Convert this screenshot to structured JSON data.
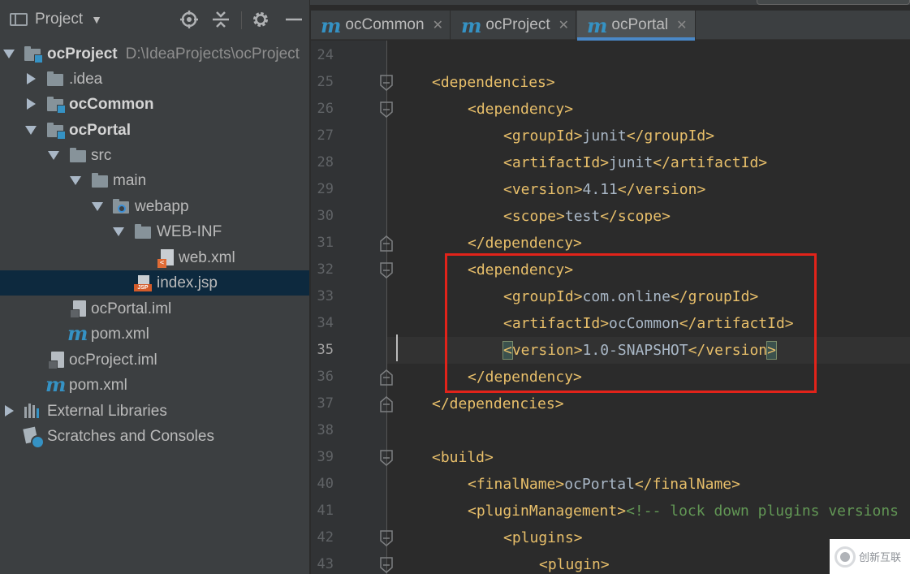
{
  "project_panel": {
    "title": "Project",
    "tree": [
      {
        "label": "ocProject",
        "path": "D:\\IdeaProjects\\ocProject"
      },
      {
        "label": ".idea"
      },
      {
        "label": "ocCommon"
      },
      {
        "label": "ocPortal"
      },
      {
        "label": "src"
      },
      {
        "label": "main"
      },
      {
        "label": "webapp"
      },
      {
        "label": "WEB-INF"
      },
      {
        "label": "web.xml"
      },
      {
        "label": "index.jsp"
      },
      {
        "label": "ocPortal.iml"
      },
      {
        "label": "pom.xml"
      },
      {
        "label": "ocProject.iml"
      },
      {
        "label": "pom.xml"
      },
      {
        "label": "External Libraries"
      },
      {
        "label": "Scratches and Consoles"
      }
    ]
  },
  "editor": {
    "tabs": [
      {
        "label": "ocCommon",
        "icon": "m"
      },
      {
        "label": "ocProject",
        "icon": "m"
      },
      {
        "label": "ocPortal",
        "icon": "m"
      }
    ],
    "active_tab": "ocPortal",
    "current_line": "35",
    "lines": [
      {
        "n": "24",
        "open": "",
        "text": "",
        "close": ""
      },
      {
        "n": "25",
        "open": "<dependencies>",
        "text": "",
        "close": ""
      },
      {
        "n": "26",
        "open": "<dependency>",
        "text": "",
        "close": ""
      },
      {
        "n": "27",
        "open": "<groupId>",
        "text": "junit",
        "close": "</groupId>"
      },
      {
        "n": "28",
        "open": "<artifactId>",
        "text": "junit",
        "close": "</artifactId>"
      },
      {
        "n": "29",
        "open": "<version>",
        "text": "4.11",
        "close": "</version>"
      },
      {
        "n": "30",
        "open": "<scope>",
        "text": "test",
        "close": "</scope>"
      },
      {
        "n": "31",
        "open": "</dependency>",
        "text": "",
        "close": ""
      },
      {
        "n": "32",
        "open": "<dependency>",
        "text": "",
        "close": ""
      },
      {
        "n": "33",
        "open": "<groupId>",
        "text": "com.online",
        "close": "</groupId>"
      },
      {
        "n": "34",
        "open": "<artifactId>",
        "text": "ocCommon",
        "close": "</artifactId>"
      },
      {
        "n": "35",
        "open": "<version>",
        "text": "1.0-SNAPSHOT",
        "close": "</version>"
      },
      {
        "n": "36",
        "open": "</dependency>",
        "text": "",
        "close": ""
      },
      {
        "n": "37",
        "open": "</dependencies>",
        "text": "",
        "close": ""
      },
      {
        "n": "38",
        "open": "",
        "text": "",
        "close": ""
      },
      {
        "n": "39",
        "open": "<build>",
        "text": "",
        "close": ""
      },
      {
        "n": "40",
        "open": "<finalName>",
        "text": "ocPortal",
        "close": "</finalName>"
      },
      {
        "n": "41",
        "open": "<pluginManagement>",
        "text": "",
        "close": "",
        "comment": "<!-- lock down plugins versions"
      },
      {
        "n": "42",
        "open": "<plugins>",
        "text": "",
        "close": ""
      },
      {
        "n": "43",
        "open": "<plugin>",
        "text": "",
        "close": ""
      }
    ]
  },
  "watermark": "创新互联",
  "colors": {
    "tag": "#e8bf6a",
    "text": "#a9b7c6",
    "comment": "#629755",
    "highlight_box": "#e2231a",
    "editor_bg": "#2b2b2b",
    "panel_bg": "#3c3f41",
    "selection": "#0d293e"
  }
}
